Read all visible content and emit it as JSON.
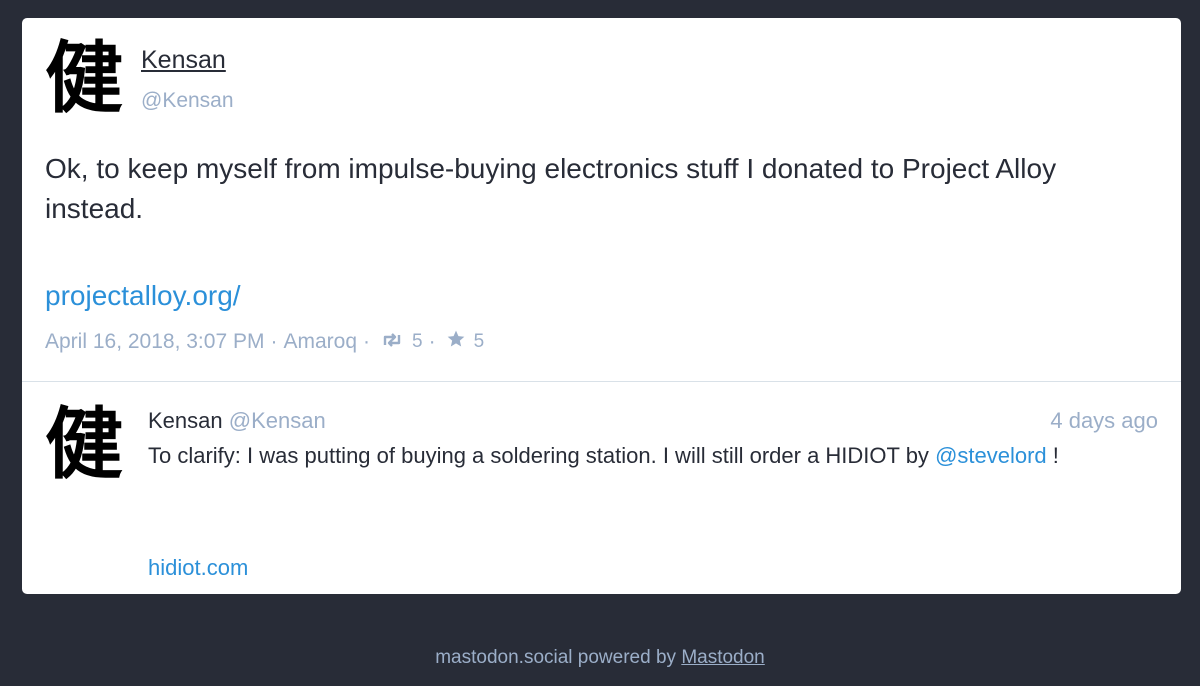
{
  "main_status": {
    "avatar_glyph": "健",
    "display_name": "Kensan",
    "acct": "@Kensan",
    "content": "Ok, to keep myself from impulse-buying electronics stuff I donated to Project Alloy instead.",
    "link": "projectalloy.org/",
    "meta": {
      "date": "April 16, 2018, 3:07 PM",
      "separator": "·",
      "app": "Amaroq",
      "boost_icon": "boost-icon",
      "boosts": "5",
      "favourite_icon": "star-icon",
      "favourites": "5"
    }
  },
  "reply": {
    "avatar_glyph": "健",
    "display_name": "Kensan",
    "acct": "@Kensan",
    "time": "4 days ago",
    "content_before": "To clarify: I was putting of buying a soldering station. I will still order a HIDIOT by",
    "mention": "@stevelord",
    "content_after": " !",
    "link": "hidiot.com"
  },
  "footer": {
    "text": "mastodon.social powered by",
    "link": "Mastodon"
  },
  "colors": {
    "background": "#282c37",
    "card": "#ffffff",
    "link": "#2b90d9",
    "muted": "#9baec8",
    "text": "#282c37"
  }
}
